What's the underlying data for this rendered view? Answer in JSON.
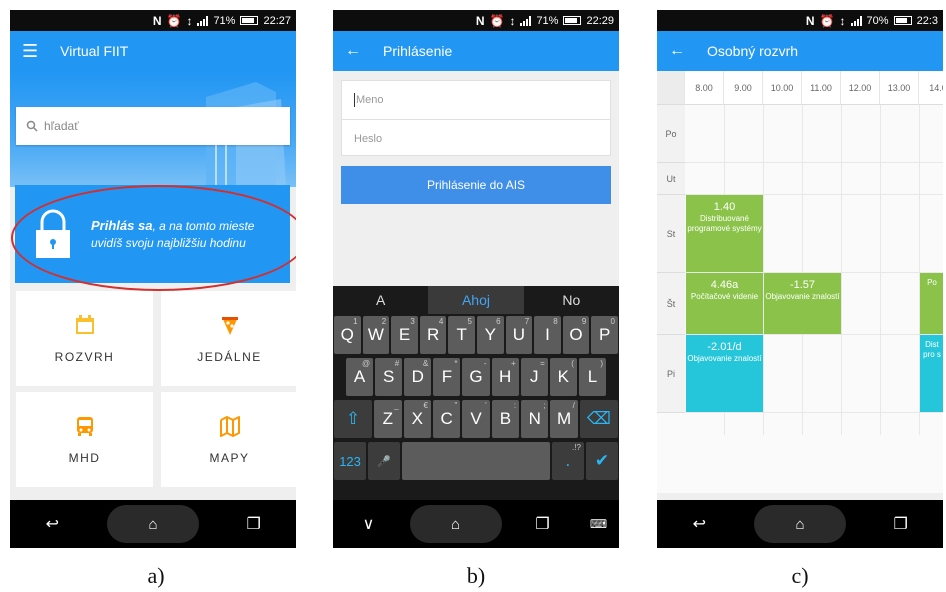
{
  "colors": {
    "primary": "#2196f3",
    "green_event": "#8bc34a",
    "cyan_event": "#26c6da",
    "highlight_ellipse": "#d32f2f"
  },
  "phone_a": {
    "status": {
      "icons": [
        "N",
        "⏰",
        "↕"
      ],
      "battery": "71%",
      "time": "22:27"
    },
    "app_title": "Virtual FIIT",
    "search_placeholder": "hľadať",
    "login_card": {
      "bold": "Prihlás sa",
      "rest_line1": ", a na tomto mieste",
      "line2": "uvidíš svoju najbližšiu hodinu"
    },
    "tiles": [
      {
        "label": "ROZVRH",
        "icon": "calendar-icon"
      },
      {
        "label": "JEDÁLNE",
        "icon": "pizza-icon"
      },
      {
        "label": "MHD",
        "icon": "bus-icon"
      },
      {
        "label": "MAPY",
        "icon": "map-icon"
      }
    ],
    "nav": {
      "back": "↩",
      "home": "⌂",
      "recents": "❐"
    }
  },
  "phone_b": {
    "status": {
      "icons": [
        "N",
        "⏰",
        "↕"
      ],
      "battery": "71%",
      "time": "22:29"
    },
    "app_title": "Prihlásenie",
    "name_placeholder": "Meno",
    "password_placeholder": "Heslo",
    "login_button": "Prihlásenie do AIS",
    "suggestions": [
      "A",
      "Ahoj",
      "No"
    ],
    "row1": [
      [
        "Q",
        "1"
      ],
      [
        "W",
        "2"
      ],
      [
        "E",
        "3"
      ],
      [
        "R",
        "4"
      ],
      [
        "T",
        "5"
      ],
      [
        "Y",
        "6"
      ],
      [
        "U",
        "7"
      ],
      [
        "I",
        "8"
      ],
      [
        "O",
        "9"
      ],
      [
        "P",
        "0"
      ]
    ],
    "row2": [
      [
        "A",
        "@"
      ],
      [
        "S",
        "#"
      ],
      [
        "D",
        "&"
      ],
      [
        "F",
        "*"
      ],
      [
        "G",
        "-"
      ],
      [
        "H",
        "+"
      ],
      [
        "J",
        "="
      ],
      [
        "K",
        "("
      ],
      [
        "L",
        ")"
      ]
    ],
    "row3": [
      [
        "Z",
        "_"
      ],
      [
        "X",
        "€"
      ],
      [
        "C",
        "\""
      ],
      [
        "V",
        "'"
      ],
      [
        "B",
        ":"
      ],
      [
        "N",
        ";"
      ],
      [
        "M",
        "/"
      ]
    ],
    "key_shift": "⇧",
    "key_backspace": "⌫",
    "key_numbers": "123",
    "key_punct": ".!?",
    "key_period": ".",
    "key_mic": "🎤",
    "key_done": "✔",
    "nav": {
      "back": "∨",
      "home": "⌂",
      "recents": "❐",
      "keyboard": "⌨"
    }
  },
  "phone_c": {
    "status": {
      "icons": [
        "N",
        "⏰",
        "↕"
      ],
      "battery": "70%",
      "time": "22:3"
    },
    "app_title": "Osobný rozvrh",
    "hours": [
      "8.00",
      "9.00",
      "10.00",
      "11.00",
      "12.00",
      "13.00",
      "14.0"
    ],
    "days": [
      "Po",
      "Ut",
      "St",
      "Št",
      "Pi"
    ],
    "events": [
      {
        "room": "1.40",
        "name": "Distribuované programové systémy",
        "color": "green"
      },
      {
        "room": "4.46a",
        "name": "Počítačové videnie",
        "color": "green"
      },
      {
        "room": "-1.57",
        "name": "Objavovanie znalostí",
        "color": "green"
      },
      {
        "room": "",
        "name": "Po",
        "color": "green"
      },
      {
        "room": "-2.01/d",
        "name": "Objavovanie znalostí",
        "color": "cyan"
      },
      {
        "room": "",
        "name": "Dist pro s",
        "color": "cyan"
      }
    ],
    "nav": {
      "back": "↩",
      "home": "⌂",
      "recents": "❐"
    }
  },
  "captions": [
    "a)",
    "b)",
    "c)"
  ]
}
